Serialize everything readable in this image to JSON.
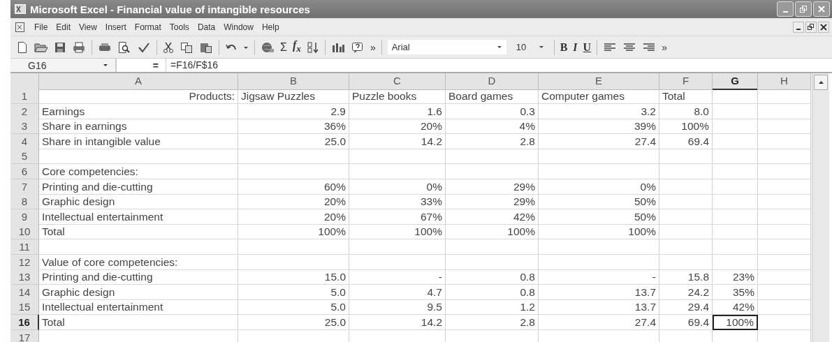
{
  "window": {
    "title": "Microsoft Excel - Financial value of intangible resources"
  },
  "menu": [
    "File",
    "Edit",
    "View",
    "Insert",
    "Format",
    "Tools",
    "Data",
    "Window",
    "Help"
  ],
  "toolbar": {
    "sum": "Σ",
    "function": "f$_{x}$",
    "more_left": "»",
    "font": "Arial",
    "size": "10",
    "bold": "B",
    "italic": "I",
    "underline": "U",
    "more_right": "»"
  },
  "formula_bar": {
    "name_box": "G16",
    "equals": "=",
    "formula": "=F16/F$16"
  },
  "columns": [
    {
      "label": "A",
      "selected": false
    },
    {
      "label": "B",
      "selected": false
    },
    {
      "label": "C",
      "selected": false
    },
    {
      "label": "D",
      "selected": false
    },
    {
      "label": "E",
      "selected": false
    },
    {
      "label": "F",
      "selected": false
    },
    {
      "label": "G",
      "selected": true
    },
    {
      "label": "H",
      "selected": false
    }
  ],
  "rows": [
    {
      "number": "1",
      "selected": false,
      "kind": "header",
      "cells": {
        "A": "Products:",
        "B": "Jigsaw Puzzles",
        "C": "Puzzle books",
        "D": "Board games",
        "E": "Computer games",
        "F": "Total"
      }
    },
    {
      "number": "2",
      "selected": false,
      "kind": "data",
      "cells": {
        "A": "Earnings",
        "B": "2.9",
        "C": "1.6",
        "D": "0.3",
        "E": "3.2",
        "F": "8.0"
      }
    },
    {
      "number": "3",
      "selected": false,
      "kind": "data",
      "cells": {
        "A": "Share in earnings",
        "B": "36%",
        "C": "20%",
        "D": "4%",
        "E": "39%",
        "F": "100%"
      }
    },
    {
      "number": "4",
      "selected": false,
      "kind": "data",
      "cells": {
        "A": "Share in intangible value",
        "B": "25.0",
        "C": "14.2",
        "D": "2.8",
        "E": "27.4",
        "F": "69.4"
      }
    },
    {
      "number": "5",
      "selected": false,
      "cells": {}
    },
    {
      "number": "6",
      "selected": false,
      "kind": "data",
      "cells": {
        "A": "Core competencies:"
      }
    },
    {
      "number": "7",
      "selected": false,
      "kind": "data",
      "cells": {
        "A": "Printing and die-cutting",
        "B": "60%",
        "C": "0%",
        "D": "29%",
        "E": "0%"
      }
    },
    {
      "number": "8",
      "selected": false,
      "kind": "data",
      "cells": {
        "A": "Graphic design",
        "B": "20%",
        "C": "33%",
        "D": "29%",
        "E": "50%"
      }
    },
    {
      "number": "9",
      "selected": false,
      "kind": "data",
      "cells": {
        "A": "Intellectual entertainment",
        "B": "20%",
        "C": "67%",
        "D": "42%",
        "E": "50%"
      }
    },
    {
      "number": "10",
      "selected": false,
      "kind": "data",
      "cells": {
        "A": "Total",
        "B": "100%",
        "C": "100%",
        "D": "100%",
        "E": "100%"
      }
    },
    {
      "number": "11",
      "selected": false,
      "cells": {}
    },
    {
      "number": "12",
      "selected": false,
      "kind": "data",
      "cells": {
        "A": "Value of core competencies:"
      }
    },
    {
      "number": "13",
      "selected": false,
      "kind": "data",
      "cells": {
        "A": "Printing and die-cutting",
        "B": "15.0",
        "C": "-",
        "D": "0.8",
        "E": "-",
        "F": "15.8",
        "G": "23%"
      }
    },
    {
      "number": "14",
      "selected": false,
      "kind": "data",
      "cells": {
        "A": "Graphic design",
        "B": "5.0",
        "C": "4.7",
        "D": "0.8",
        "E": "13.7",
        "F": "24.2",
        "G": "35%"
      }
    },
    {
      "number": "15",
      "selected": false,
      "kind": "data",
      "cells": {
        "A": "Intellectual entertainment",
        "B": "5.0",
        "C": "9.5",
        "D": "1.2",
        "E": "13.7",
        "F": "29.4",
        "G": "42%"
      }
    },
    {
      "number": "16",
      "selected": true,
      "kind": "data",
      "cells": {
        "A": "Total",
        "B": "25.0",
        "C": "14.2",
        "D": "2.8",
        "E": "27.4",
        "F": "69.4",
        "G": "100%"
      }
    },
    {
      "number": "17",
      "selected": false,
      "cells": {}
    }
  ]
}
